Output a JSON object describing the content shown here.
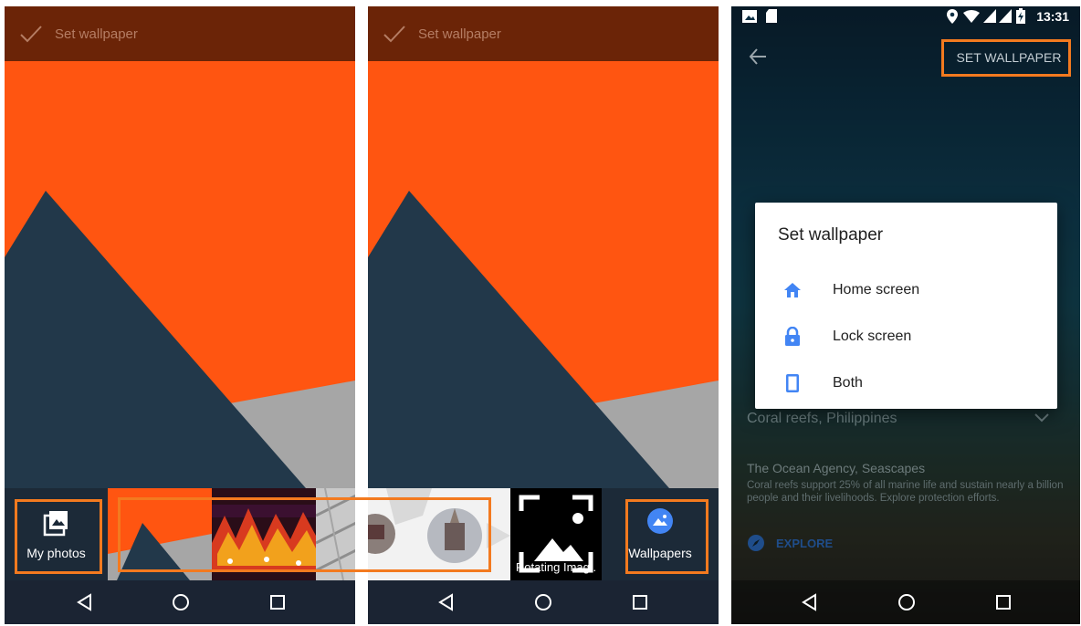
{
  "screens": {
    "left": {
      "title": "Set wallpaper",
      "my_photos_label": "My photos",
      "nav": [
        "back-icon",
        "home-icon",
        "recents-icon"
      ]
    },
    "middle": {
      "title": "Set wallpaper",
      "rotating_label": "Rotating Imag..",
      "wallpapers_label": "Wallpapers",
      "nav": [
        "back-icon",
        "home-icon",
        "recents-icon"
      ]
    },
    "right": {
      "status_time": "13:31",
      "set_wallpaper_button": "SET WALLPAPER",
      "dialog": {
        "title": "Set wallpaper",
        "options": [
          {
            "label": "Home screen",
            "icon": "home-icon"
          },
          {
            "label": "Lock screen",
            "icon": "lock-icon"
          },
          {
            "label": "Both",
            "icon": "phone-icon"
          }
        ]
      },
      "location": "Coral reefs, Philippines",
      "attribution": "The Ocean Agency, Seascapes",
      "description": "Coral reefs support 25% of all marine life and sustain nearly a billion people and their livelihoods. Explore protection efforts.",
      "explore_label": "EXPLORE"
    }
  },
  "colors": {
    "accent_orange": "#f37a1f",
    "wallpaper_orange": "#ff5511",
    "wallpaper_navy": "#22384a",
    "dialog_icon_blue": "#4285f4"
  }
}
